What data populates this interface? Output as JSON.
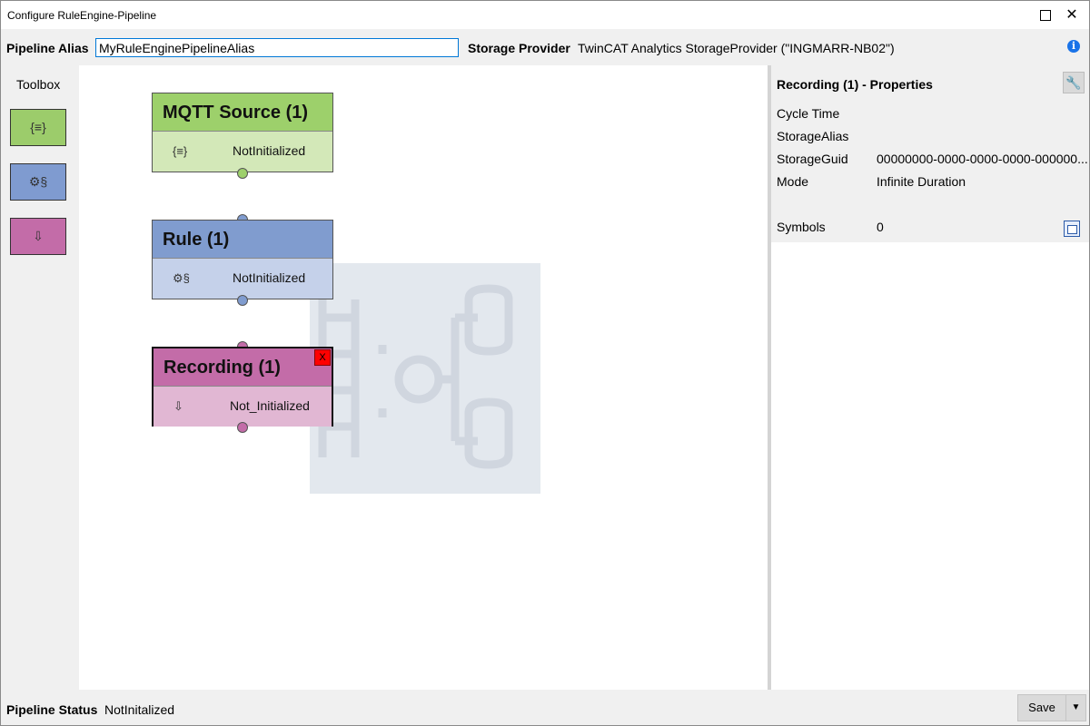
{
  "window": {
    "title": "Configure RuleEngine-Pipeline",
    "maximize_icon": "maximize-icon",
    "close_label": "✕"
  },
  "topbar": {
    "alias_label": "Pipeline Alias",
    "alias_value": "MyRuleEnginePipelineAlias",
    "storage_label": "Storage Provider",
    "storage_value": "TwinCAT Analytics StorageProvider (\"INGMARR-NB02\")",
    "info_label": "i"
  },
  "toolbox": {
    "title": "Toolbox",
    "tools": [
      {
        "name": "mqtt-source-tool",
        "icon": "{≡}",
        "color": "#9ccc6b"
      },
      {
        "name": "rule-tool",
        "icon": "⚙§",
        "color": "#7f9bd0"
      },
      {
        "name": "recording-tool",
        "icon": "⇩",
        "color": "#c36ca8"
      }
    ]
  },
  "nodes": [
    {
      "title": "MQTT Source (1)",
      "status": "NotInitialized",
      "icon": "{≡}",
      "head_color": "#9dd06b",
      "body_color": "#d3e8b8",
      "selected": false
    },
    {
      "title": "Rule (1)",
      "status": "NotInitialized",
      "icon": "⚙§",
      "head_color": "#809ccf",
      "body_color": "#c5d1ea",
      "selected": false
    },
    {
      "title": "Recording (1)",
      "status": "Not_Initialized",
      "icon": "⇩",
      "head_color": "#c36ca8",
      "body_color": "#e1b7d3",
      "selected": true,
      "delete_label": "X"
    }
  ],
  "properties": {
    "title": "Recording (1) - Properties",
    "wrench_icon": "wrench-icon",
    "rows": [
      {
        "label": "Cycle Time",
        "value": ""
      },
      {
        "label": "StorageAlias",
        "value": ""
      },
      {
        "label": "StorageGuid",
        "value": "00000000-0000-0000-0000-000000..."
      },
      {
        "label": "Mode",
        "value": "Infinite Duration"
      },
      {
        "label": "Symbols",
        "value": "0"
      }
    ]
  },
  "status": {
    "label": "Pipeline Status",
    "value": "NotInitalized"
  },
  "save": {
    "label": "Save",
    "dropdown": "▼"
  }
}
